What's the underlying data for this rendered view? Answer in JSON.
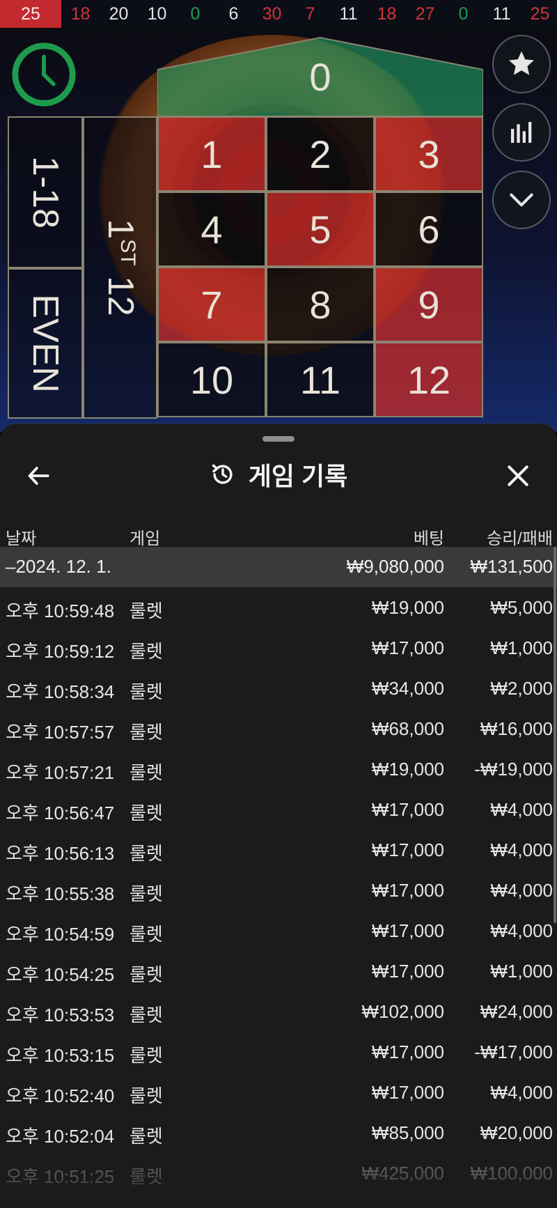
{
  "history_strip": [
    {
      "value": "25",
      "color": "red",
      "latest": true
    },
    {
      "value": "18",
      "color": "red"
    },
    {
      "value": "20",
      "color": "black"
    },
    {
      "value": "10",
      "color": "black"
    },
    {
      "value": "0",
      "color": "green"
    },
    {
      "value": "6",
      "color": "black"
    },
    {
      "value": "30",
      "color": "red"
    },
    {
      "value": "7",
      "color": "red"
    },
    {
      "value": "11",
      "color": "black"
    },
    {
      "value": "18",
      "color": "red"
    },
    {
      "value": "27",
      "color": "red"
    },
    {
      "value": "0",
      "color": "green"
    },
    {
      "value": "11",
      "color": "black"
    },
    {
      "value": "25",
      "color": "red"
    }
  ],
  "table": {
    "zero": "0",
    "numbers": [
      {
        "n": "1",
        "color": "red"
      },
      {
        "n": "2",
        "color": "black"
      },
      {
        "n": "3",
        "color": "red"
      },
      {
        "n": "4",
        "color": "black"
      },
      {
        "n": "5",
        "color": "red"
      },
      {
        "n": "6",
        "color": "black"
      },
      {
        "n": "7",
        "color": "red"
      },
      {
        "n": "8",
        "color": "black"
      },
      {
        "n": "9",
        "color": "red"
      },
      {
        "n": "10",
        "color": "black"
      },
      {
        "n": "11",
        "color": "black"
      },
      {
        "n": "12",
        "color": "red"
      }
    ],
    "low_bet": "1-18",
    "even_bet": "EVEN",
    "dozen_num": "1",
    "dozen_suffix": "ST",
    "dozen_count": "12"
  },
  "side_buttons": [
    "star-icon",
    "statistics-icon",
    "chevron-down-icon"
  ],
  "sheet": {
    "title": "게임 기록",
    "columns": {
      "date": "날짜",
      "game": "게임",
      "bet": "베팅",
      "win": "승리/패배"
    },
    "day": {
      "date": "–2024. 12. 1.",
      "bet": "₩9,080,000",
      "win": "₩131,500"
    },
    "rows": [
      {
        "time": "오후 10:59:48",
        "game": "룰렛",
        "bet": "₩19,000",
        "win": "₩5,000"
      },
      {
        "time": "오후 10:59:12",
        "game": "룰렛",
        "bet": "₩17,000",
        "win": "₩1,000"
      },
      {
        "time": "오후 10:58:34",
        "game": "룰렛",
        "bet": "₩34,000",
        "win": "₩2,000"
      },
      {
        "time": "오후 10:57:57",
        "game": "룰렛",
        "bet": "₩68,000",
        "win": "₩16,000"
      },
      {
        "time": "오후 10:57:21",
        "game": "룰렛",
        "bet": "₩19,000",
        "win": "-₩19,000"
      },
      {
        "time": "오후 10:56:47",
        "game": "룰렛",
        "bet": "₩17,000",
        "win": "₩4,000"
      },
      {
        "time": "오후 10:56:13",
        "game": "룰렛",
        "bet": "₩17,000",
        "win": "₩4,000"
      },
      {
        "time": "오후 10:55:38",
        "game": "룰렛",
        "bet": "₩17,000",
        "win": "₩4,000"
      },
      {
        "time": "오후 10:54:59",
        "game": "룰렛",
        "bet": "₩17,000",
        "win": "₩4,000"
      },
      {
        "time": "오후 10:54:25",
        "game": "룰렛",
        "bet": "₩17,000",
        "win": "₩1,000"
      },
      {
        "time": "오후 10:53:53",
        "game": "룰렛",
        "bet": "₩102,000",
        "win": "₩24,000"
      },
      {
        "time": "오후 10:53:15",
        "game": "룰렛",
        "bet": "₩17,000",
        "win": "-₩17,000"
      },
      {
        "time": "오후 10:52:40",
        "game": "룰렛",
        "bet": "₩17,000",
        "win": "₩4,000"
      },
      {
        "time": "오후 10:52:04",
        "game": "룰렛",
        "bet": "₩85,000",
        "win": "₩20,000"
      },
      {
        "time": "오후 10:51:25",
        "game": "룰렛",
        "bet": "₩425,000",
        "win": "₩100,000"
      }
    ]
  },
  "colors": {
    "red": "#c22a30",
    "green": "#1f9c52",
    "sheet_bg": "#1b1b1b",
    "day_row": "#3a3a3a"
  }
}
